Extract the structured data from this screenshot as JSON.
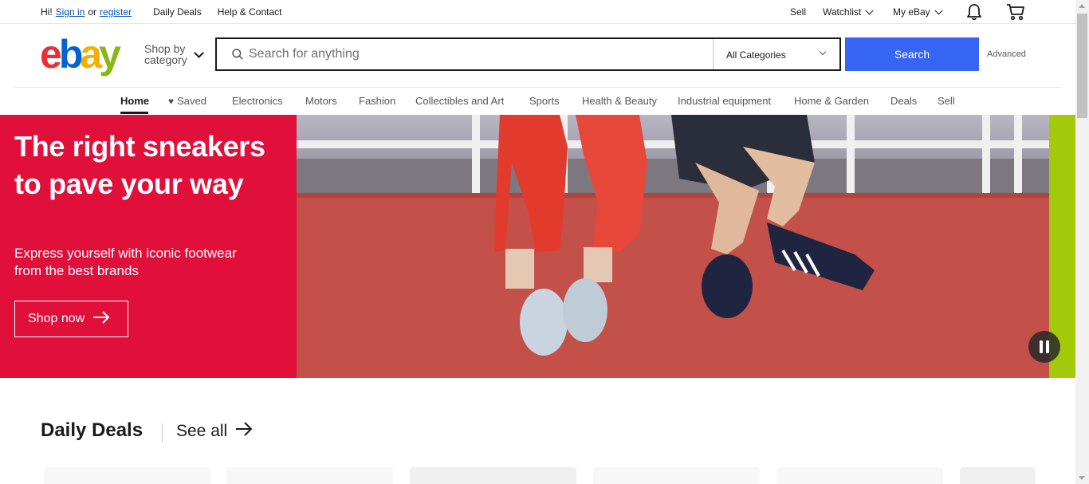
{
  "topbar": {
    "greeting": "Hi!",
    "sign_in": "Sign in",
    "or": "or",
    "register": "register",
    "daily_deals": "Daily Deals",
    "help_contact": "Help & Contact",
    "sell": "Sell",
    "watchlist": "Watchlist",
    "my_ebay": "My eBay"
  },
  "header": {
    "logo": {
      "e": "e",
      "b": "b",
      "a": "a",
      "y": "y"
    },
    "shop_by_line1": "Shop by",
    "shop_by_line2": "category",
    "search_placeholder": "Search for anything",
    "category_selected": "All Categories",
    "search_button": "Search",
    "advanced": "Advanced"
  },
  "catnav": {
    "items": [
      "Home",
      "Saved",
      "Electronics",
      "Motors",
      "Fashion",
      "Collectibles and Art",
      "Sports",
      "Health & Beauty",
      "Industrial equipment",
      "Home & Garden",
      "Deals",
      "Sell"
    ]
  },
  "hero": {
    "title": "The right sneakers to pave your way",
    "subtitle": "Express yourself with iconic footwear from the best brands",
    "button": "Shop now"
  },
  "daily_deals": {
    "title": "Daily Deals",
    "see_all": "See all"
  },
  "colors": {
    "hero_red": "#e0103a",
    "search_blue": "#3665f3",
    "link_blue": "#0654ba",
    "accent_green": "#a3c90a"
  }
}
